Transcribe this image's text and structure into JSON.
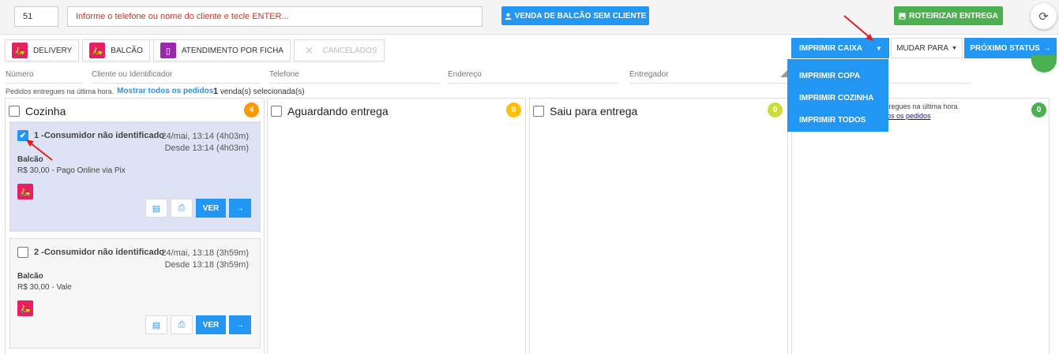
{
  "topbar": {
    "store_number": "51",
    "client_placeholder": "Informe o telefone ou nome do cliente e tecle ENTER...",
    "counter_sale_label": "VENDA DE BALCÃO SEM CLIENTE",
    "route_label": "ROTEIRIZAR ENTREGA"
  },
  "tabs": [
    {
      "label": "DELIVERY",
      "color": "#e91e63"
    },
    {
      "label": "BALCÃO",
      "color": "#e91e63"
    },
    {
      "label": "ATENDIMENTO POR FICHA",
      "color": "#9c27b0"
    },
    {
      "label": "CANCELADOS"
    }
  ],
  "actions": {
    "print_label": "IMPRIMIR CAIXA",
    "change_label": "MUDAR PARA",
    "next_label": "PRÓXIMO STATUS"
  },
  "print_menu": [
    "IMPRIMIR COPA",
    "IMPRIMIR COZINHA",
    "IMPRIMIR TODOS"
  ],
  "filters": {
    "number": "Número",
    "client": "Cliente ou Identificador",
    "phone": "Telefone",
    "address": "Endereço",
    "courier": "Entregador"
  },
  "info": {
    "delivered_text": "Pedidos entregues na última hora.",
    "show_all_link": "Mostrar todos os pedidos",
    "selected_count": "1",
    "selected_text": "venda(s) selecionada(s)"
  },
  "columns": [
    {
      "title": "Cozinha",
      "count": "4",
      "color": "#ff9800"
    },
    {
      "title": "Aguardando entrega",
      "count": "0",
      "color": "#ffc107"
    },
    {
      "title": "Saiu para entrega",
      "count": "0",
      "color": "#cddc39"
    },
    {
      "title": "",
      "count": "0",
      "color": "#4caf50"
    }
  ],
  "col4": {
    "delivered_partial": "ntregues na última hora.",
    "link_partial": "dos os pedidos"
  },
  "orders": [
    {
      "title": "1 -Consumidor não identificado",
      "date": "24/mai, 13:14 (4h03m)",
      "since": "Desde 13:14 (4h03m)",
      "type": "Balcão",
      "payment": "R$ 30,00 - Pago Online via Pix",
      "ver": "VER"
    },
    {
      "title": "2 -Consumidor não identificado",
      "date": "24/mai, 13:18 (3h59m)",
      "since": "Desde 13:18 (3h59m)",
      "type": "Balcão",
      "payment": "R$ 30,00 - Vale",
      "ver": "VER"
    }
  ],
  "icons": {
    "user": "user-icon",
    "image": "image-icon",
    "refresh": "refresh-icon",
    "motorcycle": "motorcycle-icon",
    "ticket": "ticket-icon",
    "close": "close-icon",
    "receipt": "receipt-icon",
    "printer": "printer-icon",
    "arrow": "arrow-right-icon"
  }
}
